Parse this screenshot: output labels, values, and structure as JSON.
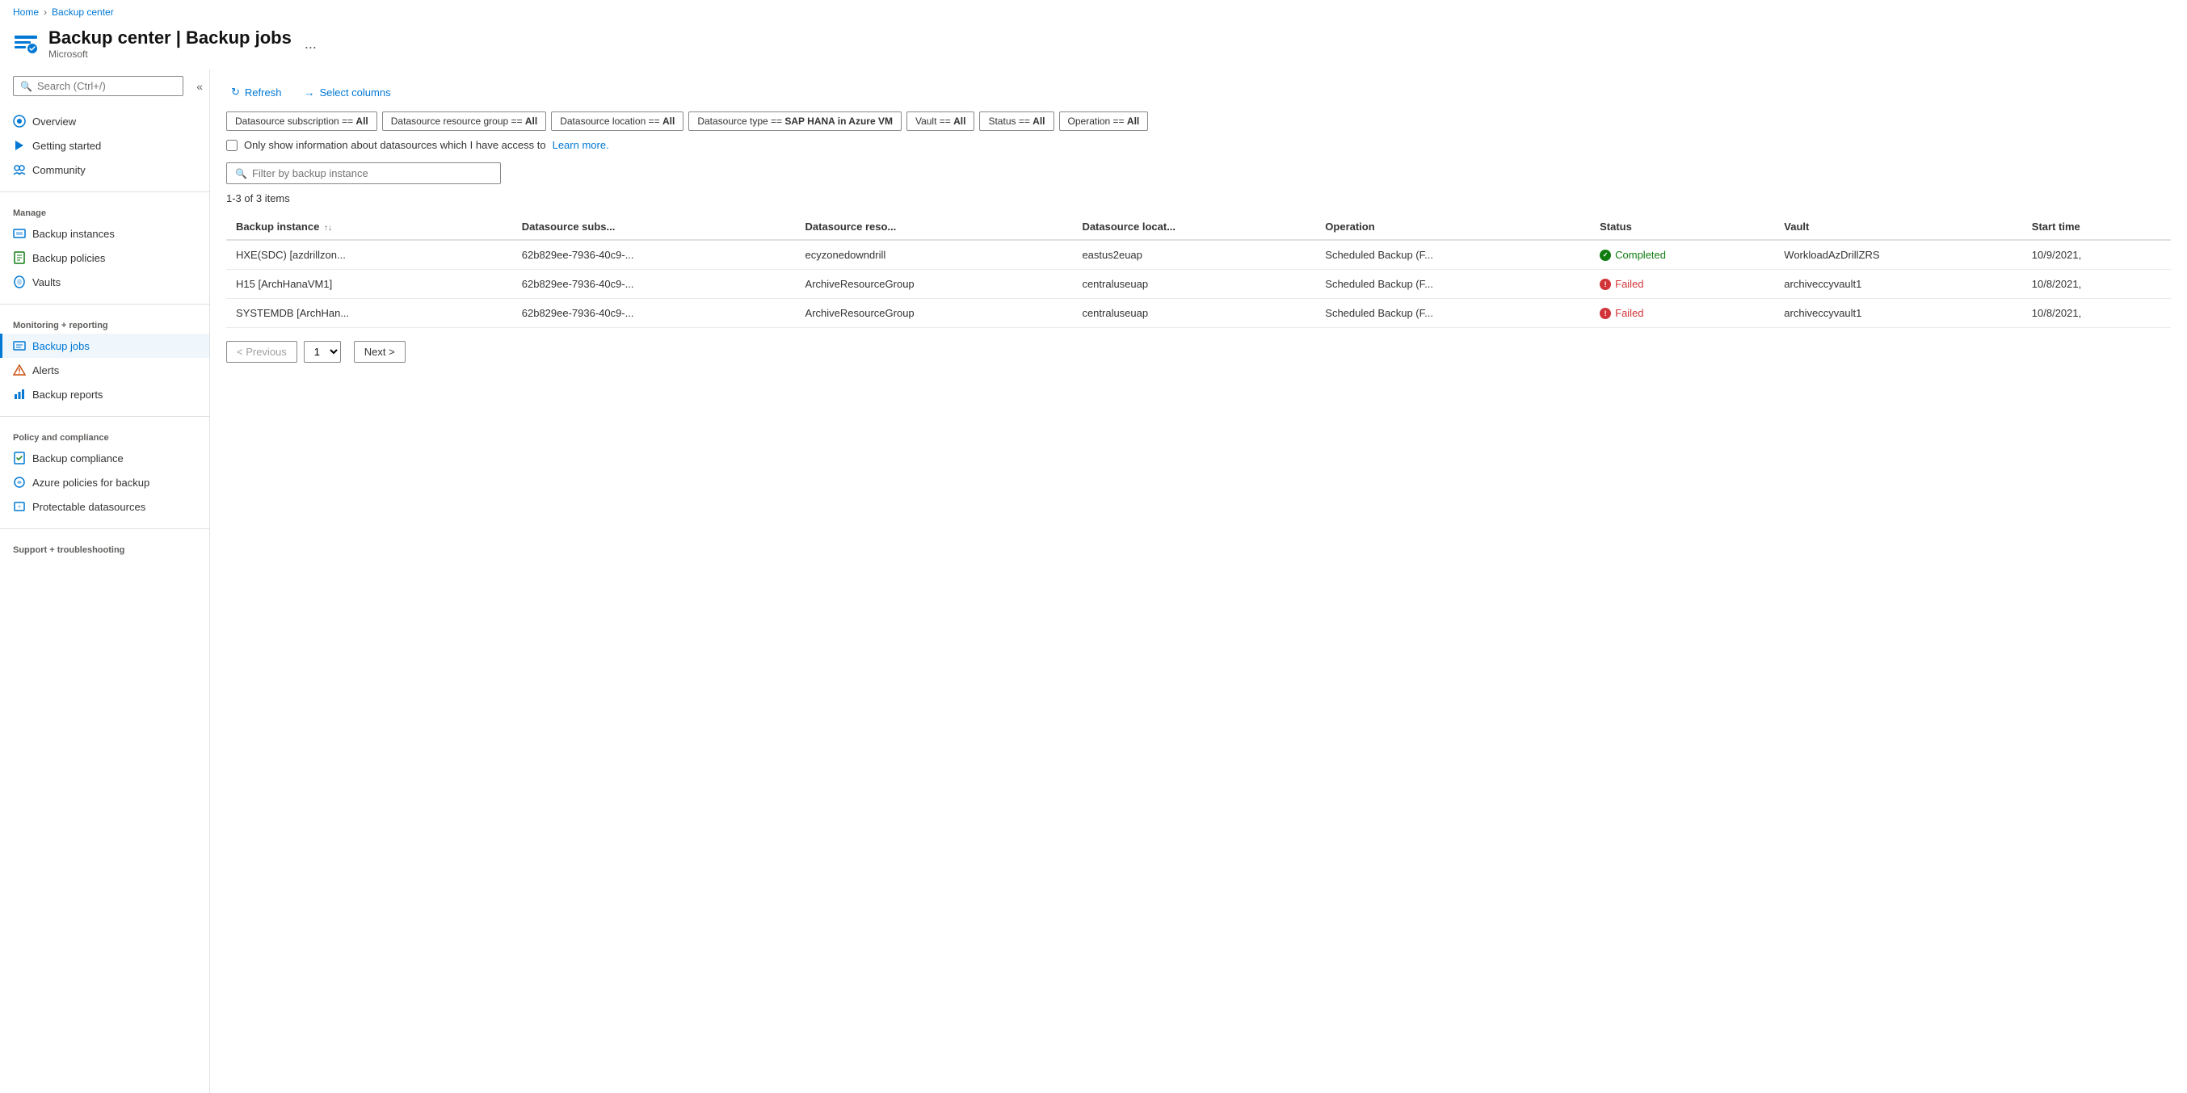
{
  "breadcrumb": {
    "home": "Home",
    "current": "Backup center"
  },
  "header": {
    "title": "Backup center | Backup jobs",
    "subtitle": "Microsoft",
    "ellipsis": "..."
  },
  "sidebar": {
    "search_placeholder": "Search (Ctrl+/)",
    "sections": [
      {
        "items": [
          {
            "id": "overview",
            "label": "Overview",
            "icon": "overview"
          },
          {
            "id": "getting-started",
            "label": "Getting started",
            "icon": "start"
          },
          {
            "id": "community",
            "label": "Community",
            "icon": "community"
          }
        ]
      },
      {
        "title": "Manage",
        "items": [
          {
            "id": "backup-instances",
            "label": "Backup instances",
            "icon": "instances"
          },
          {
            "id": "backup-policies",
            "label": "Backup policies",
            "icon": "policies"
          },
          {
            "id": "vaults",
            "label": "Vaults",
            "icon": "vaults"
          }
        ]
      },
      {
        "title": "Monitoring + reporting",
        "items": [
          {
            "id": "backup-jobs",
            "label": "Backup jobs",
            "icon": "jobs",
            "active": true
          },
          {
            "id": "alerts",
            "label": "Alerts",
            "icon": "alerts"
          },
          {
            "id": "backup-reports",
            "label": "Backup reports",
            "icon": "reports"
          }
        ]
      },
      {
        "title": "Policy and compliance",
        "items": [
          {
            "id": "backup-compliance",
            "label": "Backup compliance",
            "icon": "compliance"
          },
          {
            "id": "azure-policies",
            "label": "Azure policies for backup",
            "icon": "azure-policies"
          },
          {
            "id": "protectable-datasources",
            "label": "Protectable datasources",
            "icon": "protectable"
          }
        ]
      },
      {
        "title": "Support + troubleshooting",
        "items": []
      }
    ]
  },
  "toolbar": {
    "refresh_label": "Refresh",
    "select_columns_label": "Select columns"
  },
  "filters": [
    {
      "id": "datasource-subscription",
      "label": "Datasource subscription == ",
      "value": "All"
    },
    {
      "id": "datasource-resource-group",
      "label": "Datasource resource group == ",
      "value": "All"
    },
    {
      "id": "datasource-location",
      "label": "Datasource location == ",
      "value": "All"
    },
    {
      "id": "datasource-type",
      "label": "Datasource type == ",
      "value": "SAP HANA in Azure VM"
    },
    {
      "id": "vault",
      "label": "Vault == ",
      "value": "All"
    },
    {
      "id": "status",
      "label": "Status == ",
      "value": "All"
    },
    {
      "id": "operation",
      "label": "Operation == ",
      "value": "All"
    }
  ],
  "datasource_checkbox": {
    "label": "Only show information about datasources which I have access to",
    "learn_more": "Learn more."
  },
  "filter_input": {
    "placeholder": "Filter by backup instance"
  },
  "items_count": "1-3 of 3 items",
  "table": {
    "columns": [
      {
        "id": "backup-instance",
        "label": "Backup instance",
        "sortable": true
      },
      {
        "id": "datasource-subs",
        "label": "Datasource subs..."
      },
      {
        "id": "datasource-reso",
        "label": "Datasource reso..."
      },
      {
        "id": "datasource-locat",
        "label": "Datasource locat..."
      },
      {
        "id": "operation",
        "label": "Operation"
      },
      {
        "id": "status",
        "label": "Status"
      },
      {
        "id": "vault",
        "label": "Vault"
      },
      {
        "id": "start-time",
        "label": "Start time"
      }
    ],
    "rows": [
      {
        "backup_instance": "HXE(SDC) [azdrillzon...",
        "datasource_subs": "62b829ee-7936-40c9-...",
        "datasource_reso": "ecyzonedowndrill",
        "datasource_locat": "eastus2euap",
        "operation": "Scheduled Backup (F...",
        "status": "Completed",
        "status_type": "completed",
        "vault": "WorkloadAzDrillZRS",
        "start_time": "10/9/2021,"
      },
      {
        "backup_instance": "H15 [ArchHanaVM1]",
        "datasource_subs": "62b829ee-7936-40c9-...",
        "datasource_reso": "ArchiveResourceGroup",
        "datasource_locat": "centraluseuap",
        "operation": "Scheduled Backup (F...",
        "status": "Failed",
        "status_type": "failed",
        "vault": "archiveccyvault1",
        "start_time": "10/8/2021,"
      },
      {
        "backup_instance": "SYSTEMDB [ArchHan...",
        "datasource_subs": "62b829ee-7936-40c9-...",
        "datasource_reso": "ArchiveResourceGroup",
        "datasource_locat": "centraluseuap",
        "operation": "Scheduled Backup (F...",
        "status": "Failed",
        "status_type": "failed",
        "vault": "archiveccyvault1",
        "start_time": "10/8/2021,"
      }
    ]
  },
  "pagination": {
    "previous": "< Previous",
    "next": "Next >",
    "current_page": "1"
  }
}
